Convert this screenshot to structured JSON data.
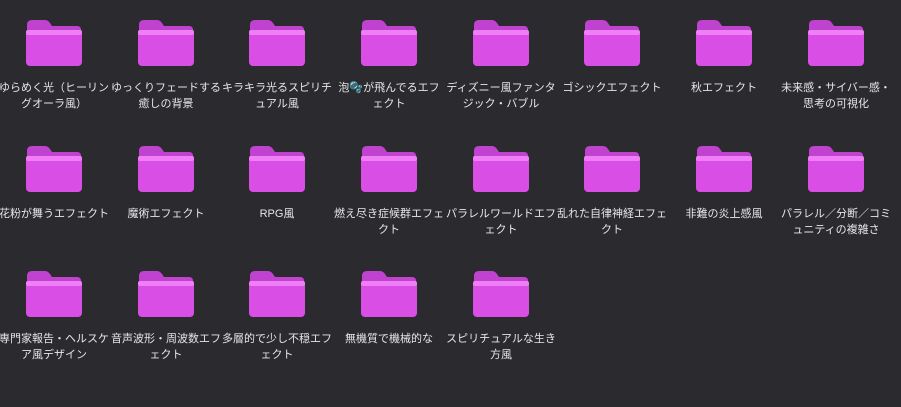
{
  "folder_icon": {
    "name": "folder-icon",
    "color_top": "#f07ef6",
    "color_body": "#d94fe5",
    "color_tab": "#c043d0"
  },
  "folders": [
    {
      "label": "ゆらめく光（ヒーリングオーラ風）"
    },
    {
      "label": "ゆっくりフェードする癒しの背景"
    },
    {
      "label": "キラキラ光るスピリチュアル風"
    },
    {
      "label": "泡🫧が飛んでるエフェクト"
    },
    {
      "label": "ディズニー風ファンタジック・バブル"
    },
    {
      "label": "ゴシックエフェクト"
    },
    {
      "label": "秋エフェクト"
    },
    {
      "label": "未来感・サイバー感・思考の可視化"
    },
    {
      "label": "花粉が舞うエフェクト"
    },
    {
      "label": "魔術エフェクト"
    },
    {
      "label": "RPG風"
    },
    {
      "label": "燃え尽き症候群エフェクト"
    },
    {
      "label": "パラレルワールドエフェクト"
    },
    {
      "label": "乱れた自律神経エフェクト"
    },
    {
      "label": "非難の炎上感風"
    },
    {
      "label": "パラレル／分断／コミュニティの複雑さ"
    },
    {
      "label": "専門家報告・ヘルスケア風デザイン"
    },
    {
      "label": "音声波形・周波数エフェクト"
    },
    {
      "label": "多層的で少し不穏エフェクト"
    },
    {
      "label": "無機質で機械的な"
    },
    {
      "label": "スピリチュアルな生き方風"
    }
  ]
}
